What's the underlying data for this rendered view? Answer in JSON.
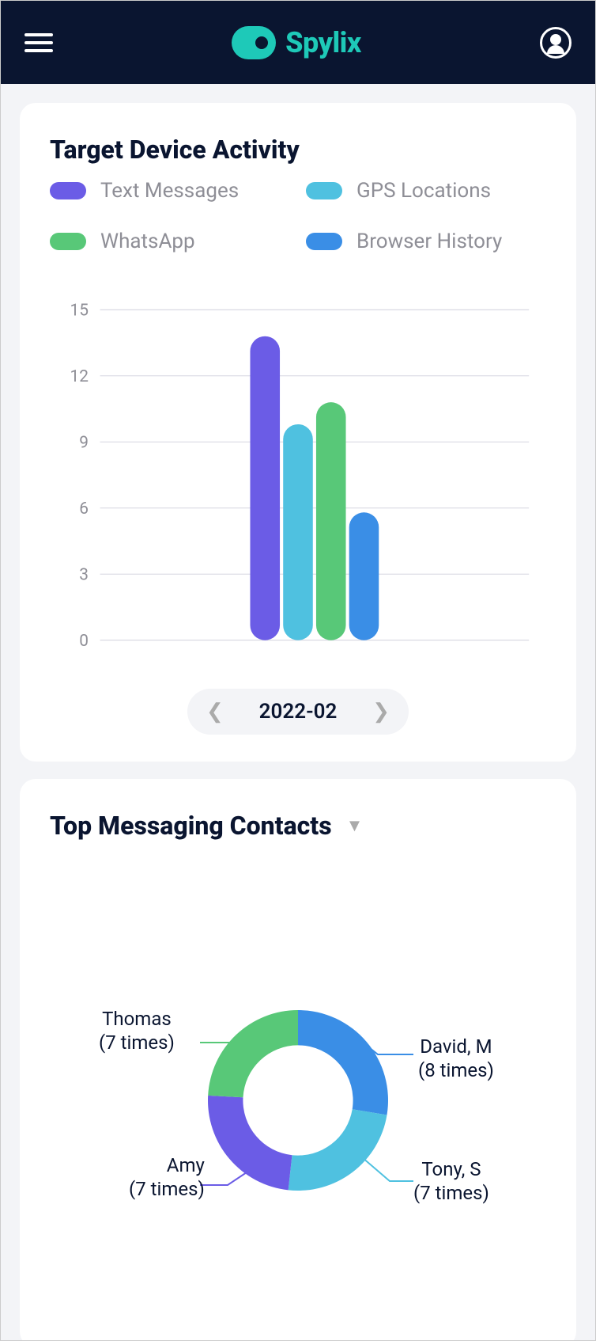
{
  "brand": "Spylix",
  "card1": {
    "title": "Target Device Activity",
    "legend": [
      {
        "label": "Text Messages",
        "color": "#6b5ce6"
      },
      {
        "label": "GPS Locations",
        "color": "#4fc1e0"
      },
      {
        "label": "WhatsApp",
        "color": "#58c878"
      },
      {
        "label": "Browser History",
        "color": "#3a8ee6"
      }
    ],
    "date": "2022-02"
  },
  "card2": {
    "title": "Top Messaging Contacts",
    "contacts": [
      {
        "name": "David, M",
        "sub": "(8 times)"
      },
      {
        "name": "Tony, S",
        "sub": "(7 times)"
      },
      {
        "name": "Amy",
        "sub": "(7 times)"
      },
      {
        "name": "Thomas",
        "sub": "(7 times)"
      }
    ]
  },
  "chart_data": [
    {
      "type": "bar",
      "title": "Target Device Activity",
      "categories": [
        "Text Messages",
        "GPS Locations",
        "WhatsApp",
        "Browser History"
      ],
      "values": [
        13.8,
        9.8,
        10.8,
        5.8
      ],
      "ylim": [
        0,
        15
      ],
      "yticks": [
        0,
        3,
        6,
        9,
        12,
        15
      ],
      "xlabel": "",
      "ylabel": "",
      "colors": [
        "#6b5ce6",
        "#4fc1e0",
        "#58c878",
        "#3a8ee6"
      ]
    },
    {
      "type": "pie",
      "title": "Top Messaging Contacts",
      "series": [
        {
          "name": "David, M",
          "value": 8,
          "color": "#3a8ee6"
        },
        {
          "name": "Tony, S",
          "value": 7,
          "color": "#4fc1e0"
        },
        {
          "name": "Amy",
          "value": 7,
          "color": "#6b5ce6"
        },
        {
          "name": "Thomas",
          "value": 7,
          "color": "#58c878"
        }
      ],
      "annotations": [
        "(8 times)",
        "(7 times)",
        "(7 times)",
        "(7 times)"
      ]
    }
  ]
}
